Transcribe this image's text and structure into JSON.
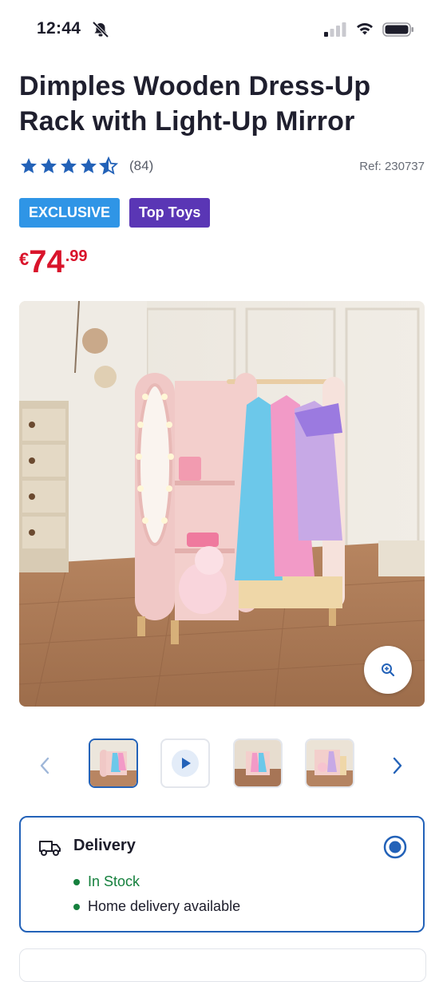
{
  "status_bar": {
    "time": "12:44"
  },
  "product": {
    "title": "Dimples Wooden Dress-Up Rack with Light-Up Mirror",
    "rating_stars": 4.5,
    "review_count": "(84)",
    "ref": "Ref: 230737",
    "badges": [
      "EXCLUSIVE",
      "Top Toys"
    ],
    "price": {
      "currency": "€",
      "whole": "74",
      "cents": ".99",
      "color": "#d9142b"
    }
  },
  "gallery": {
    "thumbnails": [
      "image",
      "video",
      "image",
      "image"
    ],
    "selected_index": 0
  },
  "delivery": {
    "title": "Delivery",
    "items": [
      "In Stock",
      "Home delivery available"
    ]
  },
  "colors": {
    "accent": "#2362b8",
    "exclusive": "#2f95e6",
    "top_toys": "#5a36b5",
    "in_stock": "#15803d"
  }
}
